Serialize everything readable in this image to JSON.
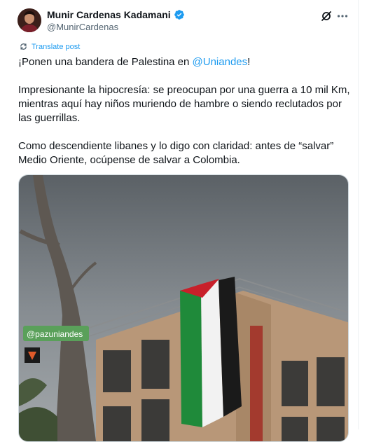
{
  "author": {
    "name": "Munir Cardenas Kadamani",
    "handle": "@MunirCardenas"
  },
  "actions": {
    "translate_label": "Translate post"
  },
  "post": {
    "line1_prefix": "¡Ponen una bandera de Palestina en ",
    "mention": "@Uniandes",
    "line1_suffix": "!",
    "paragraph2": "Impresionante la hipocresía: se preocupan por una guerra a 10 mil Km, mientras aquí hay niños muriendo de hambre o siendo reclutados por las guerrillas.",
    "paragraph3": "Como descendiente libanes y lo digo con claridad: antes de “salvar” Medio Oriente, ocúpense de salvar a Colombia."
  },
  "media": {
    "overlay_tag": "@pazuniandes"
  },
  "colors": {
    "accent": "#1d9bf0",
    "text": "#0f1419",
    "secondary": "#536471"
  },
  "icons": [
    "verified-badge-icon",
    "grok-icon",
    "more-icon",
    "translate-icon"
  ]
}
